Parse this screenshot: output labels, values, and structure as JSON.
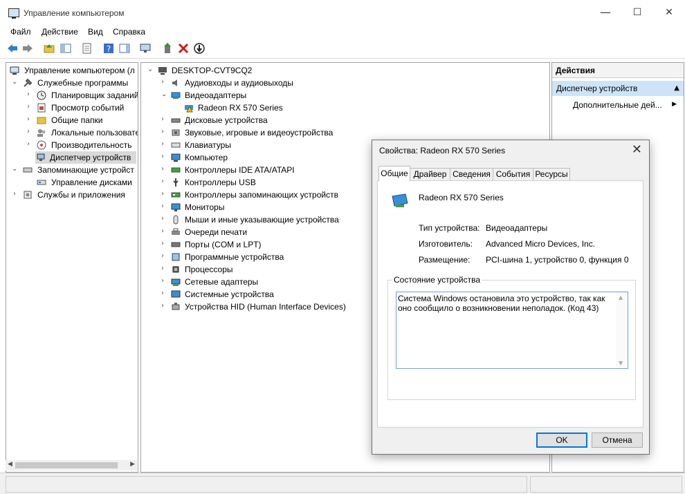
{
  "window": {
    "title": "Управление компьютером",
    "minimize": "—",
    "maximize": "☐",
    "close": "✕"
  },
  "menu": [
    "Файл",
    "Действие",
    "Вид",
    "Справка"
  ],
  "tree": [
    {
      "label": "Управление компьютером (л",
      "arrow": "",
      "icon": "computer-management-icon"
    },
    {
      "label": "Служебные программы",
      "arrow": "⌄",
      "icon": "tools-icon"
    },
    {
      "label": "Планировщик заданий",
      "arrow": "›",
      "icon": "clock-icon"
    },
    {
      "label": "Просмотр событий",
      "arrow": "›",
      "icon": "event-viewer-icon"
    },
    {
      "label": "Общие папки",
      "arrow": "›",
      "icon": "shared-folder-icon"
    },
    {
      "label": "Локальные пользовате",
      "arrow": "›",
      "icon": "users-icon"
    },
    {
      "label": "Производительность",
      "arrow": "›",
      "icon": "performance-icon"
    },
    {
      "label": "Диспетчер устройств",
      "arrow": "",
      "icon": "device-manager-icon"
    },
    {
      "label": "Запоминающие устройст",
      "arrow": "⌄",
      "icon": "storage-icon"
    },
    {
      "label": "Управление дисками",
      "arrow": "",
      "icon": "disk-management-icon"
    },
    {
      "label": "Службы и приложения",
      "arrow": "›",
      "icon": "services-icon"
    }
  ],
  "devices": {
    "root": "DESKTOP-CVT9CQ2",
    "items": [
      {
        "label": "Аудиовходы и аудиовыходы",
        "arrow": "›",
        "icon": "speaker-icon"
      },
      {
        "label": "Видеоадаптеры",
        "arrow": "⌄",
        "icon": "display-adapter-icon"
      },
      {
        "label": "Radeon RX 570 Series",
        "arrow": "",
        "icon": "warning-adapter-icon"
      },
      {
        "label": "Дисковые устройства",
        "arrow": "›",
        "icon": "disk-drive-icon"
      },
      {
        "label": "Звуковые, игровые и видеоустройства",
        "arrow": "›",
        "icon": "sound-icon"
      },
      {
        "label": "Клавиатуры",
        "arrow": "›",
        "icon": "keyboard-icon"
      },
      {
        "label": "Компьютер",
        "arrow": "›",
        "icon": "computer-icon"
      },
      {
        "label": "Контроллеры IDE ATA/ATAPI",
        "arrow": "›",
        "icon": "ide-controller-icon"
      },
      {
        "label": "Контроллеры USB",
        "arrow": "›",
        "icon": "usb-icon"
      },
      {
        "label": "Контроллеры запоминающих устройств",
        "arrow": "›",
        "icon": "storage-controller-icon"
      },
      {
        "label": "Мониторы",
        "arrow": "›",
        "icon": "monitor-icon"
      },
      {
        "label": "Мыши и иные указывающие устройства",
        "arrow": "›",
        "icon": "mouse-icon"
      },
      {
        "label": "Очереди печати",
        "arrow": "›",
        "icon": "printer-icon"
      },
      {
        "label": "Порты (COM и LPT)",
        "arrow": "›",
        "icon": "port-icon"
      },
      {
        "label": "Программные устройства",
        "arrow": "›",
        "icon": "software-device-icon"
      },
      {
        "label": "Процессоры",
        "arrow": "›",
        "icon": "processor-icon"
      },
      {
        "label": "Сетевые адаптеры",
        "arrow": "›",
        "icon": "network-adapter-icon"
      },
      {
        "label": "Системные устройства",
        "arrow": "›",
        "icon": "system-device-icon"
      },
      {
        "label": "Устройства HID (Human Interface Devices)",
        "arrow": "›",
        "icon": "hid-icon"
      }
    ]
  },
  "actions": {
    "header": "Действия",
    "selected": "Диспетчер устройств",
    "more": "Дополнительные дей..."
  },
  "dialog": {
    "title": "Свойства: Radeon RX 570 Series",
    "tabs": [
      "Общие",
      "Драйвер",
      "Сведения",
      "События",
      "Ресурсы"
    ],
    "device_name": "Radeon RX 570 Series",
    "props": [
      {
        "key": "Тип устройства:",
        "value": "Видеоадаптеры"
      },
      {
        "key": "Изготовитель:",
        "value": "Advanced Micro Devices, Inc."
      },
      {
        "key": "Размещение:",
        "value": "PCI-шина 1, устройство 0, функция 0"
      }
    ],
    "status_label": "Состояние устройства",
    "status_text": "Система Windows остановила это устройство, так как оно сообщило о возникновении неполадок. (Код 43)",
    "ok": "OK",
    "cancel": "Отмена"
  },
  "colors": {
    "selection": "#cde3f7",
    "accent": "#0078d7",
    "warning": "#f5c400",
    "delete": "#d11a1a"
  }
}
